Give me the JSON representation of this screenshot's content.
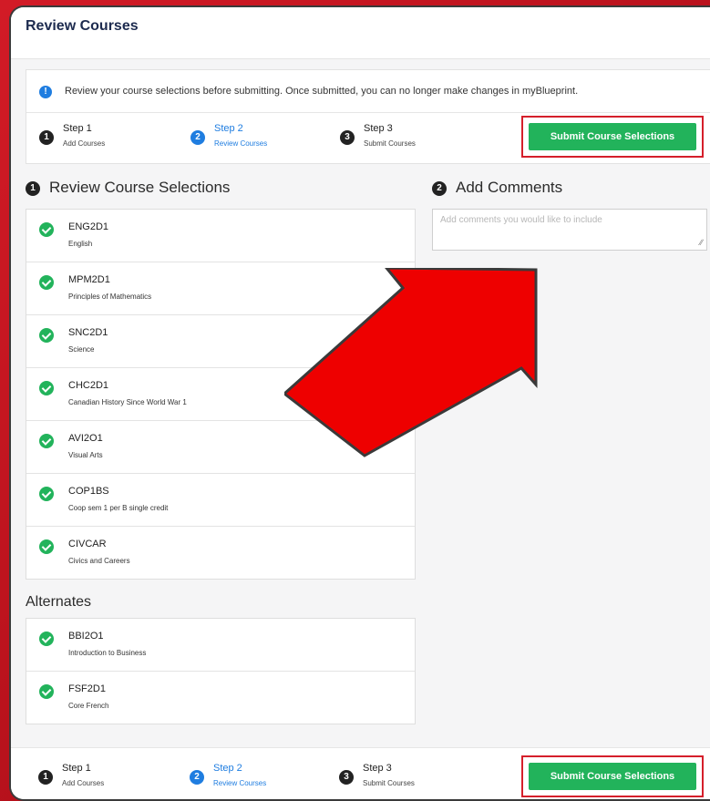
{
  "page": {
    "title": "Review Courses"
  },
  "info": {
    "message": "Review your course selections before submitting. Once submitted, you can no longer make changes in myBlueprint."
  },
  "steps": [
    {
      "num": "1",
      "label": "Step 1",
      "sub": "Add Courses"
    },
    {
      "num": "2",
      "label": "Step 2",
      "sub": "Review Courses"
    },
    {
      "num": "3",
      "label": "Step 3",
      "sub": "Submit Courses"
    }
  ],
  "submit_label": "Submit Course Selections",
  "sections": {
    "review": {
      "num": "1",
      "title": "Review Course Selections"
    },
    "comments": {
      "num": "2",
      "title": "Add Comments",
      "placeholder": "Add comments you would like to include"
    },
    "alternates_title": "Alternates"
  },
  "courses": [
    {
      "code": "ENG2D1",
      "name": "English"
    },
    {
      "code": "MPM2D1",
      "name": "Principles of Mathematics"
    },
    {
      "code": "SNC2D1",
      "name": "Science"
    },
    {
      "code": "CHC2D1",
      "name": "Canadian History Since World War 1"
    },
    {
      "code": "AVI2O1",
      "name": "Visual Arts"
    },
    {
      "code": "COP1BS",
      "name": "Coop sem 1 per B single credit"
    },
    {
      "code": "CIVCAR",
      "name": "Civics and Careers"
    }
  ],
  "alternates": [
    {
      "code": "BBI2O1",
      "name": "Introduction to Business"
    },
    {
      "code": "FSF2D1",
      "name": "Core French"
    }
  ],
  "colors": {
    "accent": "#1f7de0",
    "submit": "#22b35b",
    "highlight": "#d51f2b",
    "arrow": "#ee0000"
  },
  "icons": {
    "info": "info-icon",
    "check": "check-circle-icon",
    "arrow": "red-arrow-icon"
  }
}
